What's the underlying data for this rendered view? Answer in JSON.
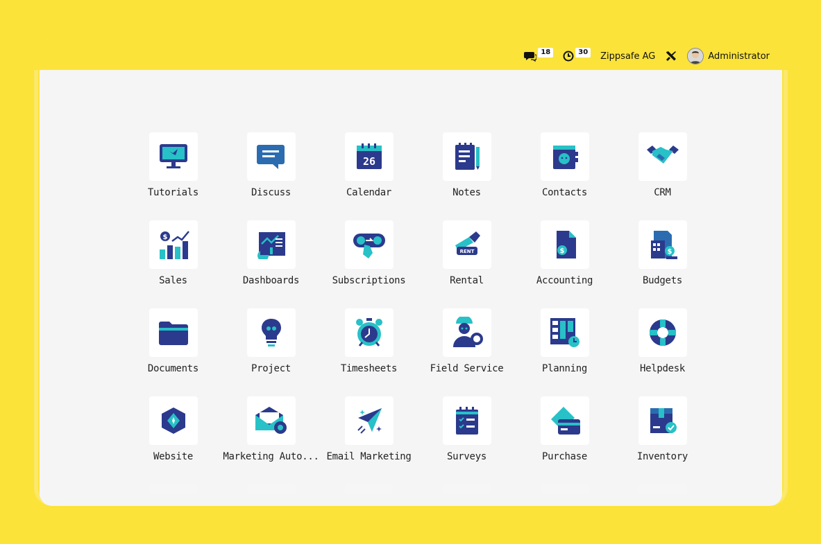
{
  "topbar": {
    "messages_count": "18",
    "activities_count": "30",
    "company": "Zippsafe AG",
    "user": "Administrator"
  },
  "apps": [
    {
      "label": "Tutorials",
      "icon": "monitor-icon"
    },
    {
      "label": "Discuss",
      "icon": "chat-bubble-icon"
    },
    {
      "label": "Calendar",
      "icon": "calendar-icon",
      "icon_text": "26"
    },
    {
      "label": "Notes",
      "icon": "notes-icon"
    },
    {
      "label": "Contacts",
      "icon": "contacts-book-icon"
    },
    {
      "label": "CRM",
      "icon": "handshake-icon"
    },
    {
      "label": "Sales",
      "icon": "sales-chart-icon"
    },
    {
      "label": "Dashboards",
      "icon": "dashboard-icon"
    },
    {
      "label": "Subscriptions",
      "icon": "subscription-icon"
    },
    {
      "label": "Rental",
      "icon": "rental-key-icon",
      "icon_text": "RENT"
    },
    {
      "label": "Accounting",
      "icon": "accounting-doc-icon"
    },
    {
      "label": "Budgets",
      "icon": "budget-calculator-icon"
    },
    {
      "label": "Documents",
      "icon": "folder-icon"
    },
    {
      "label": "Project",
      "icon": "lightbulb-icon"
    },
    {
      "label": "Timesheets",
      "icon": "alarm-clock-icon"
    },
    {
      "label": "Field Service",
      "icon": "worker-gear-icon"
    },
    {
      "label": "Planning",
      "icon": "planning-board-icon"
    },
    {
      "label": "Helpdesk",
      "icon": "lifebuoy-icon"
    },
    {
      "label": "Website",
      "icon": "globe-gem-icon"
    },
    {
      "label": "Marketing Auto...",
      "icon": "mail-gear-icon"
    },
    {
      "label": "Email Marketing",
      "icon": "paper-plane-icon"
    },
    {
      "label": "Surveys",
      "icon": "survey-clipboard-icon"
    },
    {
      "label": "Purchase",
      "icon": "credit-card-icon"
    },
    {
      "label": "Inventory",
      "icon": "box-check-icon"
    }
  ],
  "colors": {
    "background": "#FBE33A",
    "canvas": "#F5F5F5",
    "icon_dark": "#2B3A8C",
    "icon_teal": "#27C1C7"
  }
}
